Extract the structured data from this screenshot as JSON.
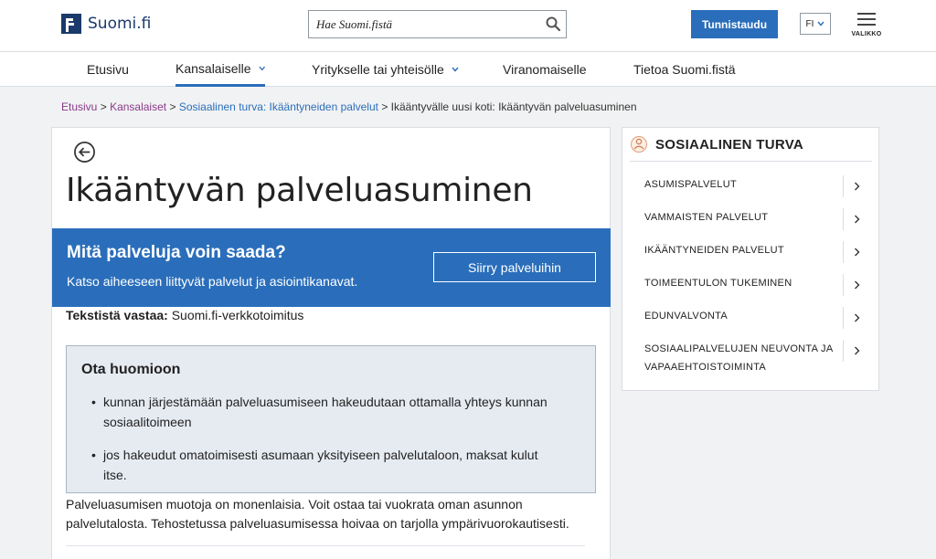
{
  "header": {
    "logo_text": "Suomi.fi",
    "search_placeholder": "Hae Suomi.fistä",
    "login_label": "Tunnistaudu",
    "language": "FI",
    "menu_label": "VALIKKO"
  },
  "nav": {
    "items": [
      {
        "label": "Etusivu"
      },
      {
        "label": "Kansalaiselle"
      },
      {
        "label": "Yritykselle tai yhteisölle"
      },
      {
        "label": "Viranomaiselle"
      },
      {
        "label": "Tietoa Suomi.fistä"
      }
    ]
  },
  "breadcrumb": {
    "items": [
      "Etusivu",
      "Kansalaiset",
      "Sosiaalinen turva: Ikääntyneiden palvelut",
      "Ikääntyvälle uusi koti: Ikääntyvän palveluasuminen"
    ],
    "separator": ">"
  },
  "article": {
    "title": "Ikääntyvän palveluasuminen",
    "cta": {
      "title": "Mitä palveluja voin saada?",
      "text": "Katso aiheeseen liittyvät palvelut ja asiointikanavat.",
      "button": "Siirry palveluihin"
    },
    "byline_label": "Tekstistä vastaa:",
    "byline_value": "Suomi.fi-verkkotoimitus",
    "notice": {
      "title": "Ota huomioon",
      "items": [
        "kunnan järjestämään palveluasumiseen hakeudutaan ottamalla yhteys kunnan sosiaalitoimeen",
        "jos hakeudut omatoimisesti asumaan yksityiseen palvelutaloon, maksat kulut itse."
      ]
    },
    "body": "Palveluasumisen muotoja on monenlaisia. Voit ostaa tai vuokrata oman asunnon palvelutalosta. Tehostetussa palveluasumisessa hoivaa on tarjolla ympärivuorokautisesti."
  },
  "sidebar": {
    "title": "SOSIAALINEN TURVA",
    "items": [
      {
        "label": "ASUMISPALVELUT"
      },
      {
        "label": "VAMMAISTEN PALVELUT"
      },
      {
        "label": "IKÄÄNTYNEIDEN PALVELUT"
      },
      {
        "label": "TOIMEENTULON TUKEMINEN"
      },
      {
        "label": "EDUNVALVONTA"
      },
      {
        "label": "SOSIAALIPALVELUJEN NEUVONTA JA VAPAAEHTOISTOIMINTA"
      }
    ]
  },
  "colors": {
    "primary": "#2a6ebb",
    "logo": "#1a3a6b",
    "visited_link": "#8a3a8a",
    "notice_bg": "#e6ebf2"
  }
}
